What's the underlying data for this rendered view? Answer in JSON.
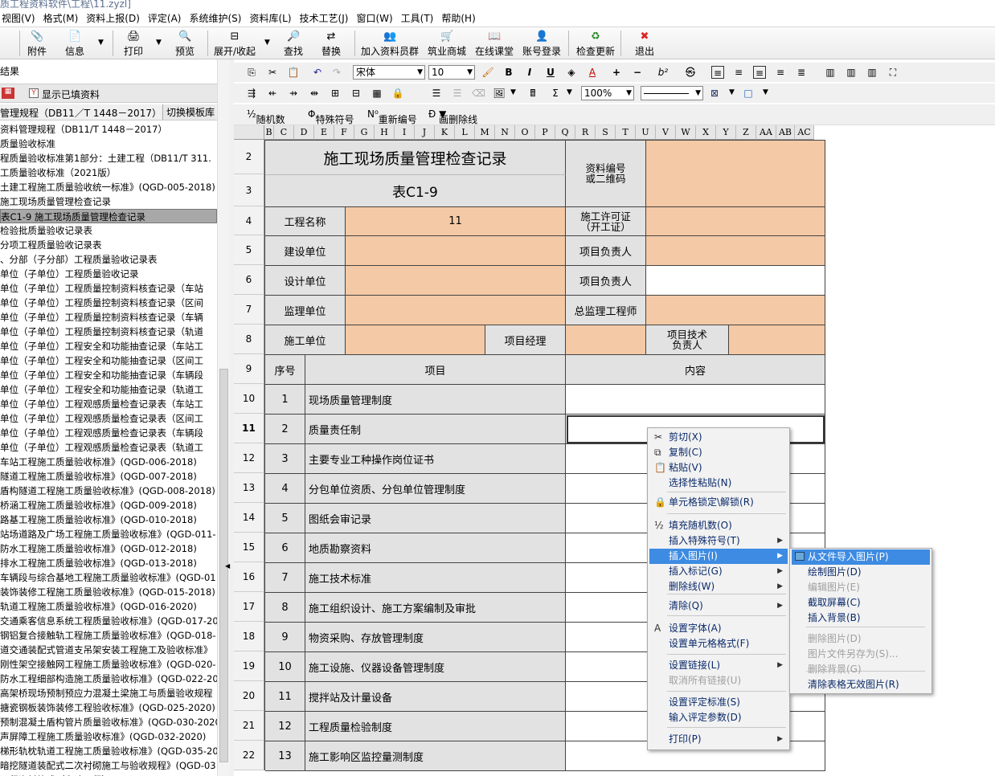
{
  "window": {
    "title": "质工程资料软件\\工程\\11.zyzl]"
  },
  "menu": [
    "视图(V)",
    "格式(M)",
    "资料上报(D)",
    "评定(A)",
    "系统维护(S)",
    "资料库(L)",
    "技术工艺(J)",
    "窗口(W)",
    "工具(T)",
    "帮助(H)"
  ],
  "toolbar": [
    {
      "icon": "paperclip-icon",
      "glyph": "📎",
      "label": "附件"
    },
    {
      "icon": "info-icon",
      "glyph": "📄",
      "label": "信息"
    },
    {
      "icon": "print-icon",
      "glyph": "🖨",
      "label": "打印"
    },
    {
      "icon": "preview-icon",
      "glyph": "🔍",
      "label": "预览"
    },
    {
      "icon": "expand-icon",
      "glyph": "⊟",
      "label": "展开/收起"
    },
    {
      "icon": "find-icon",
      "glyph": "🔎",
      "label": "查找"
    },
    {
      "icon": "replace-icon",
      "glyph": "⇄",
      "label": "替换"
    },
    {
      "icon": "group-icon",
      "glyph": "👥",
      "label": "加入资料员群"
    },
    {
      "icon": "shop-icon",
      "glyph": "🛒",
      "label": "筑业商城"
    },
    {
      "icon": "classroom-icon",
      "glyph": "📖",
      "label": "在线课堂"
    },
    {
      "icon": "account-icon",
      "glyph": "👤",
      "label": "账号登录"
    },
    {
      "icon": "update-icon",
      "glyph": "♻",
      "label": "检查更新"
    },
    {
      "icon": "exit-icon",
      "glyph": "✖",
      "label": "退出"
    }
  ],
  "left": {
    "header": "结果",
    "show_filled": "显示已填资料",
    "standard": "管理规程（DB11／T 1448－2017）",
    "switch_btn": "切换模板库",
    "tree": [
      "资料管理规程（DB11/T 1448－2017）",
      "质量验收标准",
      "程质量验收标准第1部分：土建工程（DB11/T 311.",
      "工质量验收标准（2021版）",
      "土建工程施工质量验收统一标准》(QGD-005-2018)",
      "施工现场质量管理检查记录",
      "表C1-9  施工现场质量管理检查记录",
      "检验批质量验收记录表",
      "分项工程质量验收记录表",
      "、分部（子分部）工程质量验收记录表",
      "单位（子单位）工程质量验收记录",
      "单位（子单位）工程质量控制资料核查记录（车站",
      "单位（子单位）工程质量控制资料核查记录（区间",
      "单位（子单位）工程质量控制资料核查记录（车辆",
      "单位（子单位）工程质量控制资料核查记录（轨道",
      "单位（子单位）工程安全和功能抽查记录（车站工",
      "单位（子单位）工程安全和功能抽查记录（区间工",
      "单位（子单位）工程安全和功能抽查记录（车辆段",
      "单位（子单位）工程安全和功能抽查记录（轨道工",
      "单位（子单位）工程观感质量检查记录表（车站工",
      "单位（子单位）工程观感质量检查记录表（区间工",
      "单位（子单位）工程观感质量检查记录表（车辆段",
      "单位（子单位）工程观感质量检查记录表（轨道工",
      "车站工程施工质量验收标准》(QGD-006-2018)",
      "隧道工程施工质量验收标准》(QGD-007-2018)",
      "盾构隧道工程施工质量验收标准》(QGD-008-2018)",
      "桥涵工程施工质量验收标准》(QGD-009-2018)",
      "路基工程施工质量验收标准》(QGD-010-2018)",
      "站场道路及广场工程施工质量验收标准》(QGD-011-",
      "防水工程施工质量验收标准》(QGD-012-2018)",
      "排水工程施工质量验收标准》(QGD-013-2018)",
      "车辆段与综合基地工程施工质量验收标准》(QGD-01",
      "装饰装修工程施工质量验收标准》(QGD-015-2018)",
      "轨道工程施工质量验收标准》(QGD-016-2020)",
      "交通乘客信息系统工程质量验收标准》(QGD-017-20",
      "钢铝复合接触轨工程施工质量验收标准》(QGD-018-",
      "道交通装配式管道支吊架安装工程施工及验收标准》",
      "刚性架空接触网工程施工质量验收标准》(QGD-020-",
      "防水工程细部构造施工质量验收标准》(QGD-022-20",
      "高架桥现场预制预应力混凝土梁施工与质量验收规程",
      "搪瓷钢板装饰装修工程验收标准》(QGD-025-2020)",
      "预制混凝土盾构管片质量验收标准》(QGD-030-2020",
      "声屏障工程施工质量验收标准》(QGD-032-2020)",
      "梯形轨枕轨道工程施工质量验收标准》(QGD-035-20",
      "暗挖隧道装配式二次衬砌施工与验收规程》(QGD-03",
      "工程资料格式（市政工程）"
    ],
    "selected_index": 6
  },
  "format": {
    "font": "宋体",
    "size": "10",
    "zoom": "100%",
    "row3": {
      "random": "随机数",
      "special": "特殊符号",
      "renumber": "重新编号",
      "strike": "画删除线"
    }
  },
  "columns": [
    "B",
    "C",
    "D",
    "E",
    "F",
    "G",
    "H",
    "I",
    "J",
    "K",
    "L",
    "M",
    "N",
    "O",
    "P",
    "Q",
    "R",
    "S",
    "T",
    "U",
    "V",
    "W",
    "X",
    "Y",
    "Z",
    "AA",
    "AB",
    "AC"
  ],
  "form": {
    "title": "施工现场质量管理检查记录",
    "code": "表C1-9",
    "doc_no_label": "资料编号\n或二维码",
    "project_name_label": "工程名称",
    "project_name_value": "11",
    "permit_label": "施工许可证\n（开工证）",
    "build_unit": "建设单位",
    "build_leader": "项目负责人",
    "design_unit": "设计单位",
    "design_leader": "项目负责人",
    "supervise_unit": "监理单位",
    "chief_supervisor": "总监理工程师",
    "construct_unit": "施工单位",
    "project_manager": "项目经理",
    "tech_leader": "项目技术\n负责人",
    "col_no": "序号",
    "col_item": "项目",
    "col_content": "内容",
    "items": [
      {
        "no": "1",
        "name": "现场质量管理制度"
      },
      {
        "no": "2",
        "name": "质量责任制"
      },
      {
        "no": "3",
        "name": "主要专业工种操作岗位证书"
      },
      {
        "no": "4",
        "name": "分包单位资质、分包单位管理制度"
      },
      {
        "no": "5",
        "name": "图纸会审记录"
      },
      {
        "no": "6",
        "name": "地质勘察资料"
      },
      {
        "no": "7",
        "name": "施工技术标准"
      },
      {
        "no": "8",
        "name": "施工组织设计、施工方案编制及审批"
      },
      {
        "no": "9",
        "name": "物资采购、存放管理制度"
      },
      {
        "no": "10",
        "name": "施工设施、仪器设备管理制度"
      },
      {
        "no": "11",
        "name": "搅拌站及计量设备"
      },
      {
        "no": "12",
        "name": "工程质量检验制度"
      },
      {
        "no": "13",
        "name": "施工影响区监控量测制度"
      }
    ],
    "rows": [
      "2",
      "3",
      "4",
      "5",
      "6",
      "7",
      "8",
      "9",
      "10",
      "11",
      "12",
      "13",
      "14",
      "15",
      "16",
      "17",
      "18",
      "19",
      "20",
      "21",
      "22"
    ]
  },
  "context_menu": [
    {
      "label": "剪切(X)",
      "icon": "✂"
    },
    {
      "label": "复制(C)",
      "icon": "⧉"
    },
    {
      "label": "粘贴(V)",
      "icon": "📋"
    },
    {
      "label": "选择性粘贴(N)"
    },
    {
      "label": "单元格锁定\\解锁(R)",
      "icon": "🔒"
    },
    {
      "label": "填充随机数(O)",
      "icon": "½"
    },
    {
      "label": "插入特殊符号(T)",
      "sub": true
    },
    {
      "label": "插入图片(I)",
      "sub": true,
      "hl": true
    },
    {
      "label": "插入标记(G)",
      "sub": true
    },
    {
      "label": "删除线(W)",
      "sub": true
    },
    {
      "label": "清除(Q)",
      "sub": true
    },
    {
      "label": "设置字体(A)",
      "icon": "A"
    },
    {
      "label": "设置单元格格式(F)"
    },
    {
      "label": "设置链接(L)",
      "sub": true
    },
    {
      "label": "取消所有链接(U)",
      "dis": true
    },
    {
      "label": "设置评定标准(S)"
    },
    {
      "label": "输入评定参数(D)"
    },
    {
      "label": "打印(P)",
      "sub": true
    }
  ],
  "submenu": [
    {
      "label": "从文件导入图片(P)",
      "hl": true
    },
    {
      "label": "绘制图片(D)"
    },
    {
      "label": "编辑图片(E)",
      "dis": true
    },
    {
      "label": "截取屏幕(C)"
    },
    {
      "label": "插入背景(B)"
    },
    {
      "label": "删除图片(D)",
      "dis": true
    },
    {
      "label": "图片文件另存为(S)...",
      "dis": true
    },
    {
      "label": "删除背景(G)",
      "dis": true
    },
    {
      "label": "清除表格无效图片(R)"
    }
  ]
}
